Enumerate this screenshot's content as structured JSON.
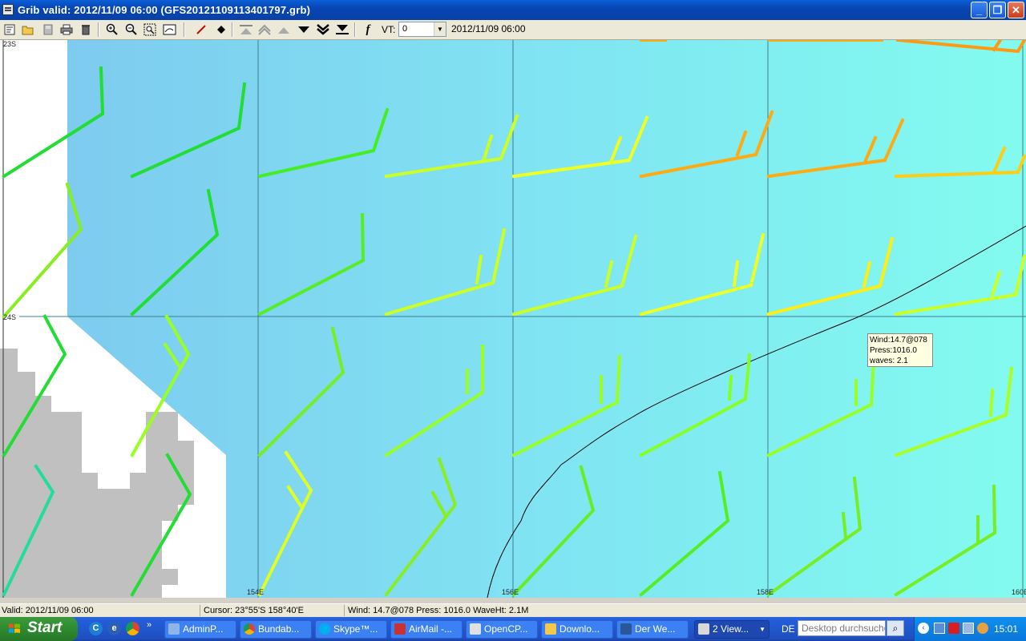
{
  "window": {
    "title": "Grib valid: 2012/11/09 06:00 (GFS20121109113401797.grb)",
    "minimize": "_",
    "maximize": "❐",
    "close": "✕"
  },
  "toolbar": {
    "vt_label": "VT:",
    "vt_value": "0",
    "vt_time": "2012/11/09 06:00"
  },
  "map": {
    "lat_labels": [
      "23S",
      "24S"
    ],
    "lon_labels": [
      "154E",
      "156E",
      "158E",
      "160E"
    ],
    "tooltip": {
      "wind": "Wind:14.7@078",
      "press": "Press:1016.0",
      "waves": "waves: 2.1"
    }
  },
  "statusbar": {
    "valid": "Valid: 2012/11/09 06:00",
    "cursor": "Cursor: 23°55'S  158°40'E",
    "readout": "Wind: 14.7@078  Press: 1016.0  WaveHt:  2.1M"
  },
  "taskbar": {
    "start": "Start",
    "tasks": [
      {
        "label": "AdminP..."
      },
      {
        "label": "Bundab..."
      },
      {
        "label": "Skype™..."
      },
      {
        "label": "AirMail -..."
      },
      {
        "label": "OpenCP..."
      },
      {
        "label": "Downlo..."
      },
      {
        "label": "Der We..."
      },
      {
        "label": "2 View..."
      }
    ],
    "language": "DE",
    "search_placeholder": "Desktop durchsuchen",
    "clock": "15:01"
  }
}
